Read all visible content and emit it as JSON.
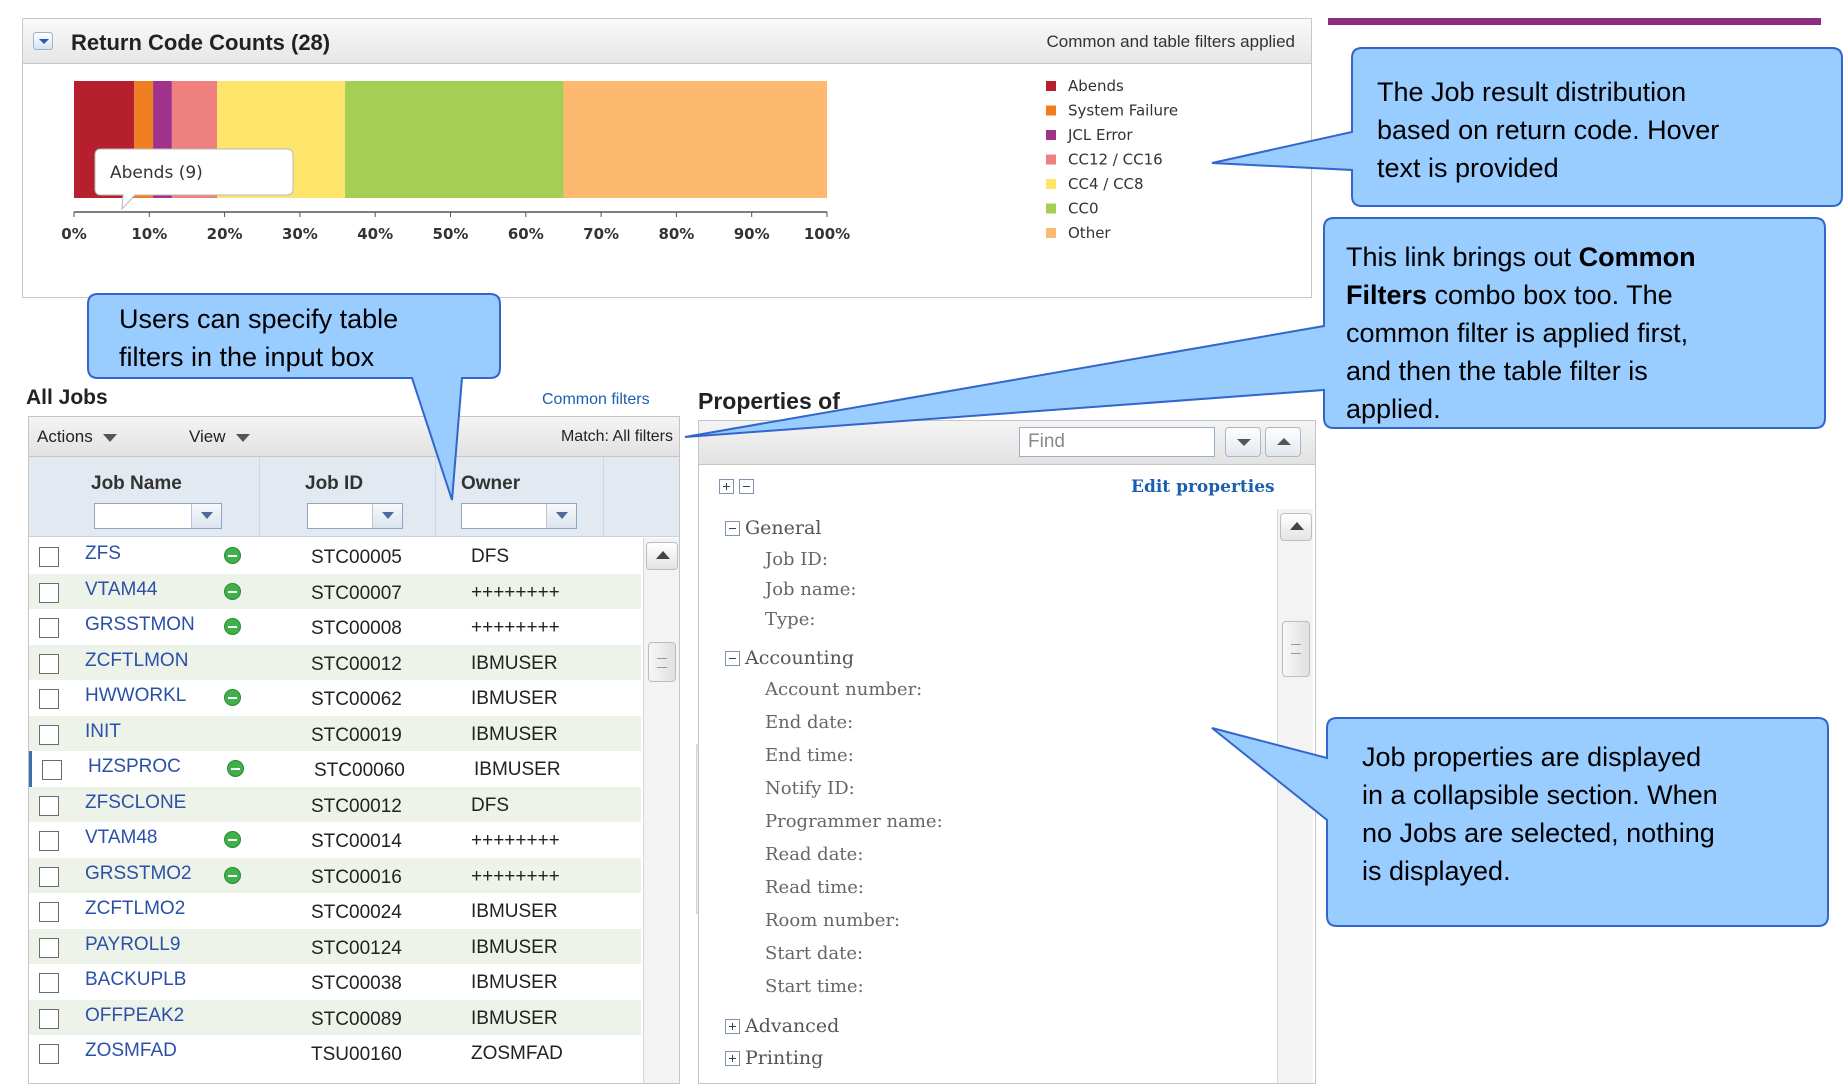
{
  "return_code_panel": {
    "title": "Return Code Counts (28)",
    "filter_note": "Common and table filters applied",
    "tooltip": "Abends (9)"
  },
  "chart_data": {
    "type": "bar",
    "orientation": "horizontal-stacked",
    "categories": [
      "Abends",
      "System Failure",
      "JCL Error",
      "CC12 / CC16",
      "CC4 / CC8",
      "CC0",
      "Other"
    ],
    "values": [
      8,
      2.5,
      2.5,
      6,
      17,
      29,
      35
    ],
    "colors": [
      "#b51f2e",
      "#ef7d22",
      "#a0328c",
      "#ef8080",
      "#fde46a",
      "#a4cf54",
      "#fdb970"
    ],
    "x_ticks": [
      "0%",
      "10%",
      "20%",
      "30%",
      "40%",
      "50%",
      "60%",
      "70%",
      "80%",
      "90%",
      "100%"
    ],
    "xlim": [
      0,
      100
    ],
    "legend_position": "right",
    "grid": false
  },
  "jobs": {
    "title": "All Jobs",
    "common_filters_link": "Common filters",
    "actions_label": "Actions",
    "view_label": "View",
    "match_label": "Match: All filters",
    "columns": [
      "Job Name",
      "Job ID",
      "Owner"
    ],
    "rows": [
      {
        "name": "ZFS",
        "id": "STC00005",
        "owner": "DFS",
        "active": true
      },
      {
        "name": "VTAM44",
        "id": "STC00007",
        "owner": "++++++++",
        "active": true
      },
      {
        "name": "GRSSTMON",
        "id": "STC00008",
        "owner": "++++++++",
        "active": true
      },
      {
        "name": "ZCFTLMON",
        "id": "STC00012",
        "owner": "IBMUSER",
        "active": false
      },
      {
        "name": "HWWORKL",
        "id": "STC00062",
        "owner": "IBMUSER",
        "active": true
      },
      {
        "name": "INIT",
        "id": "STC00019",
        "owner": "IBMUSER",
        "active": false
      },
      {
        "name": "HZSPROC",
        "id": "STC00060",
        "owner": "IBMUSER",
        "active": true
      },
      {
        "name": "ZFSCLONE",
        "id": "STC00012",
        "owner": "DFS",
        "active": false
      },
      {
        "name": "VTAM48",
        "id": "STC00014",
        "owner": "++++++++",
        "active": true
      },
      {
        "name": "GRSSTMO2",
        "id": "STC00016",
        "owner": "++++++++",
        "active": true
      },
      {
        "name": "ZCFTLMO2",
        "id": "STC00024",
        "owner": "IBMUSER",
        "active": false
      },
      {
        "name": "PAYROLL9",
        "id": "STC00124",
        "owner": "IBMUSER",
        "active": false
      },
      {
        "name": "BACKUPLB",
        "id": "STC00038",
        "owner": "IBMUSER",
        "active": false
      },
      {
        "name": "OFFPEAK2",
        "id": "STC00089",
        "owner": "IBMUSER",
        "active": false
      },
      {
        "name": "ZOSMFAD",
        "id": "TSU00160",
        "owner": "ZOSMFAD",
        "active": false
      }
    ]
  },
  "properties": {
    "title": "Properties of",
    "find_placeholder": "Find",
    "edit_link": "Edit properties",
    "general": {
      "label": "General",
      "fields": [
        "Job ID:",
        "Job name:",
        "Type:"
      ]
    },
    "accounting": {
      "label": "Accounting",
      "fields": [
        "Account number:",
        "End date:",
        "End time:",
        "Notify ID:",
        "Programmer name:",
        "Read date:",
        "Read time:",
        "Room number:",
        "Start date:",
        "Start time:"
      ]
    },
    "advanced": {
      "label": "Advanced"
    },
    "printing": {
      "label": "Printing"
    }
  },
  "callouts": {
    "distribution": [
      "The Job result distribution",
      "based on return code. Hover",
      "text is provided"
    ],
    "common_filters": {
      "line1_pre": "This link brings out ",
      "line1_bold": "Common",
      "line2_bold": "Filters",
      "line2_post": " combo box too. The",
      "line3": "common filter is applied first,",
      "line4": "and then the table filter is",
      "line5": "applied."
    },
    "table_filters": [
      "Users can specify table",
      "filters in the input box"
    ],
    "job_properties": [
      "Job properties are displayed",
      "in a collapsible section. When",
      "no Jobs are selected, nothing",
      "is displayed."
    ]
  },
  "colors": {
    "accent_line": "#8c2d7f",
    "callout_fill": "#99ccff",
    "callout_stroke": "#3366cc",
    "link": "#1b5fb0"
  }
}
